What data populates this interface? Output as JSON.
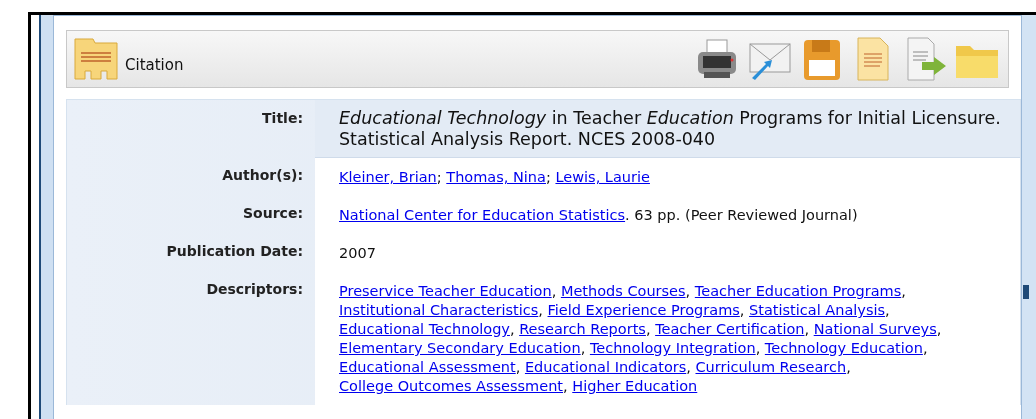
{
  "toolbar": {
    "title": "Citation",
    "actions": [
      {
        "kind": "print"
      },
      {
        "kind": "email"
      },
      {
        "kind": "save"
      },
      {
        "kind": "document"
      },
      {
        "kind": "export"
      },
      {
        "kind": "folder"
      }
    ]
  },
  "fields": [
    {
      "label": "Title:",
      "kind": "title",
      "text": "*Educational Technology* in Teacher *Education* Programs for Initial Licensure. Statistical Analysis Report. NCES 2008-040"
    },
    {
      "label": "Author(s):",
      "kind": "links",
      "links": [
        {
          "text": "Kleiner, Brian",
          "after": ";"
        },
        {
          "text": "Thomas, Nina",
          "after": ";"
        },
        {
          "text": "Lewis, Laurie"
        }
      ]
    },
    {
      "label": "Source:",
      "kind": "links",
      "links": [
        {
          "text": "National Center for Education Statistics",
          "after": ". 63 pp. (Peer Reviewed Journal)"
        }
      ]
    },
    {
      "label": "Publication Date:",
      "kind": "text",
      "text": "2007"
    },
    {
      "label": "Descriptors:",
      "kind": "links",
      "links": [
        {
          "text": "Preservice Teacher Education",
          "after": ","
        },
        {
          "text": "Methods Courses",
          "after": ","
        },
        {
          "text": "Teacher Education Programs",
          "after": ","
        },
        {
          "text": "Institutional Characteristics",
          "after": ","
        },
        {
          "text": "Field Experience Programs",
          "after": ","
        },
        {
          "text": "Statistical Analysis",
          "after": ","
        },
        {
          "text": "Educational Technology",
          "after": ","
        },
        {
          "text": "Research Reports",
          "after": ","
        },
        {
          "text": "Teacher Certification",
          "after": ","
        },
        {
          "text": "National Surveys",
          "after": ","
        },
        {
          "text": "Elementary Secondary Education",
          "after": ","
        },
        {
          "text": "Technology Integration",
          "after": ","
        },
        {
          "text": "Technology Education",
          "after": ","
        },
        {
          "text": "Educational Assessment",
          "after": ","
        },
        {
          "text": "Educational Indicators",
          "after": ","
        },
        {
          "text": "Curriculum Research",
          "after": ","
        },
        {
          "text": "College Outcomes Assessment",
          "after": ","
        },
        {
          "text": "Higher Education"
        }
      ]
    }
  ]
}
